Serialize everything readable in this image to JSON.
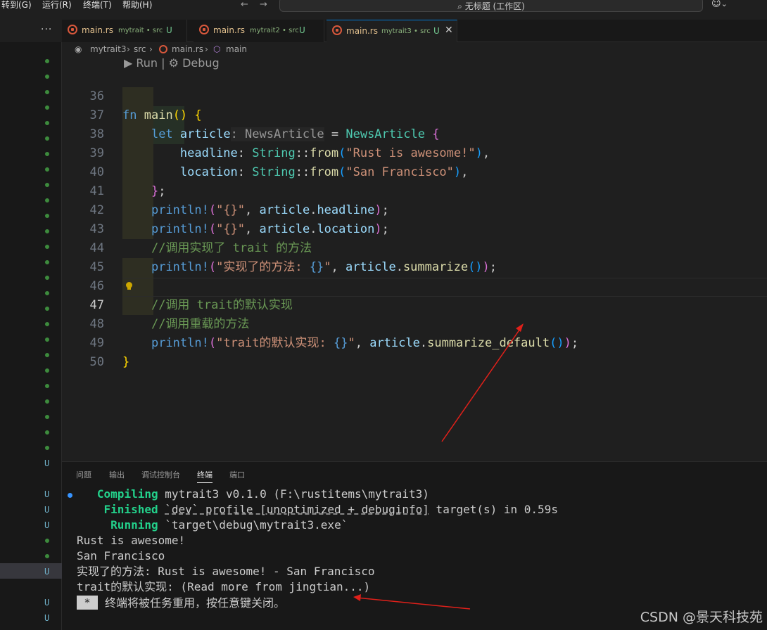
{
  "menu": {
    "goto": "转到(G)",
    "run": "运行(R)",
    "terminal": "终端(T)",
    "help": "帮助(H)"
  },
  "nav": {
    "back": "←",
    "forward": "→"
  },
  "command_center": {
    "search_glyph": "⌕",
    "title": "无标题 (工作区)"
  },
  "copilot": {
    "glyph": "☺",
    "chevron": "⌄"
  },
  "tabs_more": "···",
  "tabs": [
    {
      "name": "main.rs",
      "desc": "mytrait • src",
      "status": "U"
    },
    {
      "name": "main.rs",
      "desc": "mytrait2 • src",
      "status": "U"
    },
    {
      "name": "main.rs",
      "desc": "mytrait3 • src",
      "status": "U",
      "close": "✕"
    }
  ],
  "breadcrumb": {
    "root_icon": "◉",
    "root": "mytrait3",
    "sep": "›",
    "src": "src",
    "file": "main.rs",
    "symbol_icon": "⬡",
    "symbol": "main"
  },
  "codelens": {
    "run": "▶ Run",
    "sep": " | ",
    "debug": "⚙ Debug"
  },
  "editor": {
    "line_numbers": [
      "36",
      "37",
      "38",
      "39",
      "40",
      "41",
      "42",
      "43",
      "44",
      "45",
      "46",
      "47",
      "48",
      "49",
      "50"
    ],
    "current_line": "47",
    "tokens": {
      "l36": {
        "fn": "fn",
        "name": "main",
        "paren": "()",
        "brace": "{"
      },
      "l37": {
        "let": "let",
        "var": "article",
        "hint": ": NewsArticle",
        "eq": " = ",
        "type": "NewsArticle",
        "brace": "{"
      },
      "l38": {
        "field": "headline",
        "colon": ": ",
        "type": "String",
        "sep": "::",
        "fn": "from",
        "open": "(",
        "str": "\"Rust is awesome!\"",
        "close": ")",
        "comma": ","
      },
      "l39": {
        "field": "location",
        "colon": ": ",
        "type": "String",
        "sep": "::",
        "fn": "from",
        "open": "(",
        "str": "\"San Francisco\"",
        "close": ")",
        "comma": ","
      },
      "l40": {
        "brace": "}",
        "semi": ";"
      },
      "l41": {
        "mac": "println!",
        "open": "(",
        "str": "\"{}\"",
        "mid": ", ",
        "var": "article",
        "dot": ".",
        "field": "headline",
        "close": ")",
        "semi": ";"
      },
      "l42": {
        "mac": "println!",
        "open": "(",
        "str": "\"{}\"",
        "mid": ", ",
        "var": "article",
        "dot": ".",
        "field": "location",
        "close": ")",
        "semi": ";"
      },
      "l43": {
        "comment": "//调用实现了 trait 的方法"
      },
      "l44": {
        "mac": "println!",
        "open": "(",
        "str1": "\"实现了的方法: ",
        "esc": "{}",
        "str2": "\"",
        "mid": ", ",
        "var": "article",
        "dot": ".",
        "fn": "summarize",
        "call": "()",
        "close": ")",
        "semi": ";"
      },
      "l46": {
        "comment": "//调用 trait的默认实现"
      },
      "l47": {
        "comment": "//调用重载的方法"
      },
      "l48": {
        "mac": "println!",
        "open": "(",
        "str1": "\"trait的默认实现: ",
        "esc": "{}",
        "str2": "\"",
        "mid": ", ",
        "var": "article",
        "dot": ".",
        "fn": "summarize_default",
        "call": "()",
        "close": ")",
        "semi": ";"
      },
      "l49": {
        "brace": "}"
      }
    }
  },
  "panel": {
    "tabs": [
      "问题",
      "输出",
      "调试控制台",
      "终端",
      "端口"
    ],
    "active_tab": "终端",
    "terminal": {
      "compiling_kw": "Compiling",
      "compiling_rest": " mytrait3 v0.1.0 (F:\\rustitems\\mytrait3)",
      "finished_kw": "Finished",
      "finished_profile": "`dev` profile [unoptimized + debuginfo]",
      "finished_rest": " target(s) in 0.59s",
      "running_kw": "Running",
      "running_rest": " `target\\debug\\mytrait3.exe`",
      "out1": "Rust is awesome!",
      "out2": "San Francisco",
      "out3": "实现了的方法: Rust is awesome! - San Francisco",
      "out4": "trait的默认实现: (Read more from jingtian...)",
      "badge": "*",
      "close_msg": "终端将被任务重用，按任意键关闭。"
    }
  },
  "gutter_status": "U",
  "watermark": "CSDN @景天科技苑",
  "colors": {
    "accent": "#0078d4",
    "annotation_arrow": "#e0201a"
  }
}
